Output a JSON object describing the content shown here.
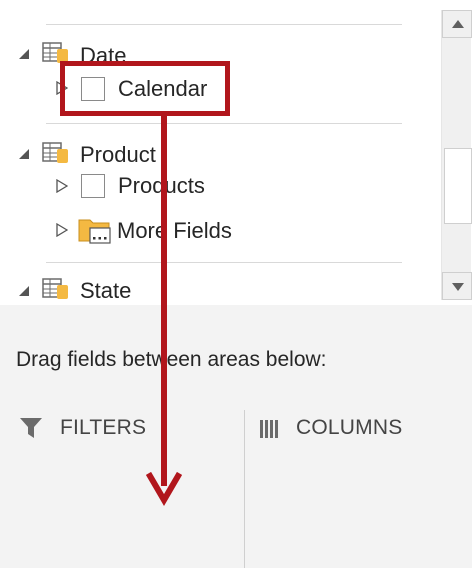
{
  "field_list": {
    "tables": [
      {
        "name": "Date",
        "expanded": true
      },
      {
        "name": "Product",
        "expanded": true
      },
      {
        "name": "State",
        "expanded": true
      }
    ],
    "fields": {
      "calendar": {
        "label": "Calendar",
        "checked": false
      },
      "products": {
        "label": "Products",
        "checked": false
      },
      "more_fields": {
        "label": "More Fields"
      }
    }
  },
  "drag_hint": "Drag fields between areas below:",
  "areas": {
    "filters": "FILTERS",
    "columns": "COLUMNS"
  },
  "colors": {
    "highlight": "#b1161c",
    "table_icon_accent": "#f4b942",
    "folder": "#f4b942"
  }
}
